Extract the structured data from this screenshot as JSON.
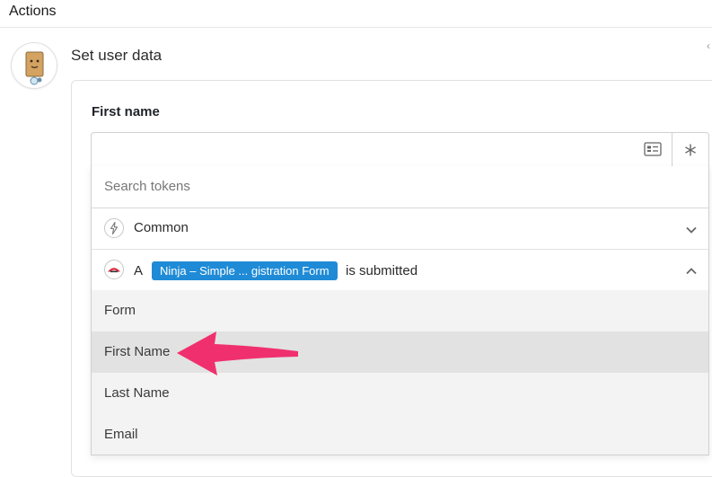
{
  "header": {
    "title": "Actions"
  },
  "step": {
    "title": "Set user data",
    "avatar_icon": "bot-avatar-icon"
  },
  "field": {
    "label": "First name",
    "value": ""
  },
  "token_picker": {
    "search_placeholder": "Search tokens",
    "groups": [
      {
        "label": "Common",
        "icon": "lightning-icon",
        "expanded": false
      },
      {
        "prefix": "A",
        "pill": "Ninja – Simple ... gistration Form",
        "suffix": "is submitted",
        "icon": "ninja-forms-icon",
        "expanded": true,
        "items": [
          "Form",
          "First Name",
          "Last Name",
          "Email"
        ]
      }
    ],
    "highlighted_item": "First Name"
  },
  "colors": {
    "pill": "#1f8bd6",
    "arrow": "#f0306e",
    "item_bg": "#f3f3f3",
    "item_active_bg": "#e2e2e2"
  }
}
